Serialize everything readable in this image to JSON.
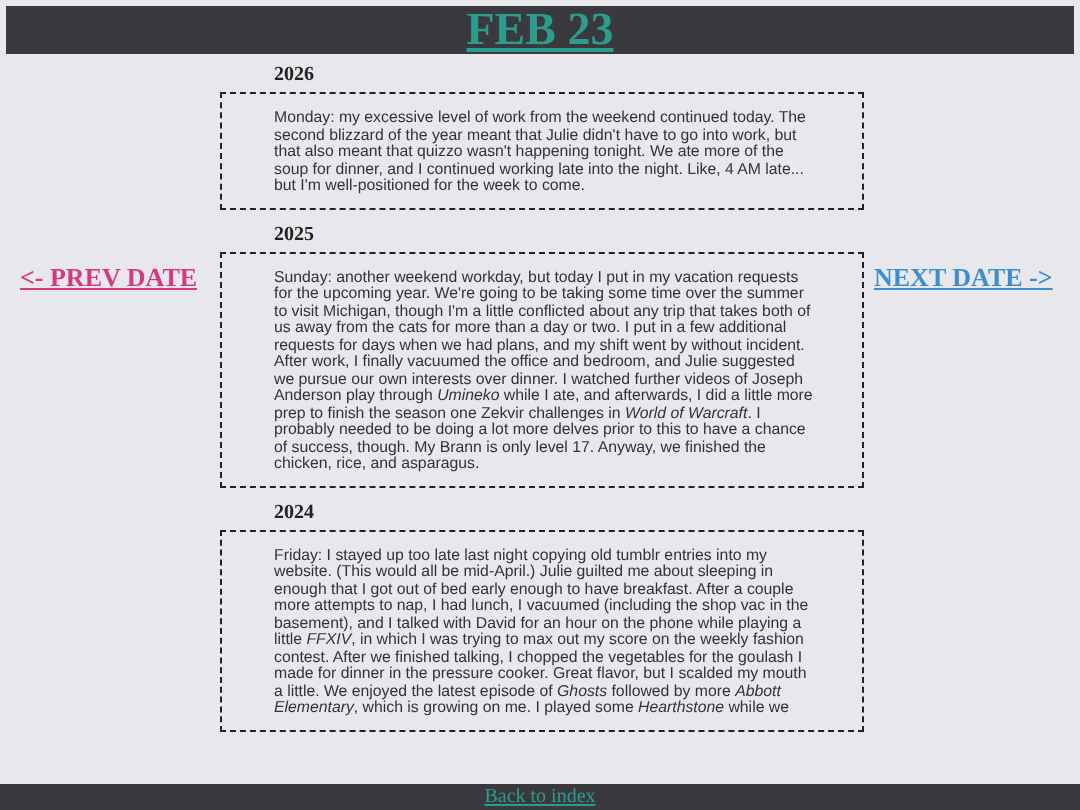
{
  "header": {
    "title": "FEB 23"
  },
  "nav": {
    "prev": "<- PREV DATE",
    "next": "NEXT DATE ->"
  },
  "entries": [
    {
      "year": "2026",
      "text": "Monday: my excessive level of work from the weekend continued today. The second blizzard of the year meant that Julie didn't have to go into work, but that also meant that quizzo wasn't happening tonight. We ate more of the soup for dinner, and I continued working late into the night. Like, 4 AM late... but I'm well-positioned for the week to come."
    },
    {
      "year": "2025",
      "text": "Sunday: another weekend workday, but today I put in my vacation requests for the upcoming year. We're going to be taking some time over the summer to visit Michigan, though I'm a little conflicted about any trip that takes both of us away from the cats for more than a day or two. I put in a few additional requests for days when we had plans, and my shift went by without incident. After work, I finally vacuumed the office and bedroom, and Julie suggested we pursue our own interests over dinner. I watched further videos of Joseph Anderson play through *Umineko* while I ate, and afterwards, I did a little more prep to finish the season one Zekvir challenges in *World of Warcraft*. I probably needed to be doing a lot more delves prior to this to have a chance of success, though. My Brann is only level 17. Anyway, we finished the chicken, rice, and asparagus."
    },
    {
      "year": "2024",
      "text": "Friday: I stayed up too late last night copying old tumblr entries into my website. (This would all be mid-April.) Julie guilted me about sleeping in enough that I got out of bed early enough to have breakfast. After a couple more attempts to nap, I had lunch, I vacuumed (including the shop vac in the basement), and I talked with David for an hour on the phone while playing a little *FFXIV*, in which I was trying to max out my score on the weekly fashion contest. After we finished talking, I chopped the vegetables for the goulash I made for dinner in the pressure cooker. Great flavor, but I scalded my mouth a little. We enjoyed the latest episode of *Ghosts* followed by more *Abbott Elementary*, which is growing on me. I played some *Hearthstone* while we"
    }
  ],
  "footer": {
    "link": "Back to index"
  }
}
